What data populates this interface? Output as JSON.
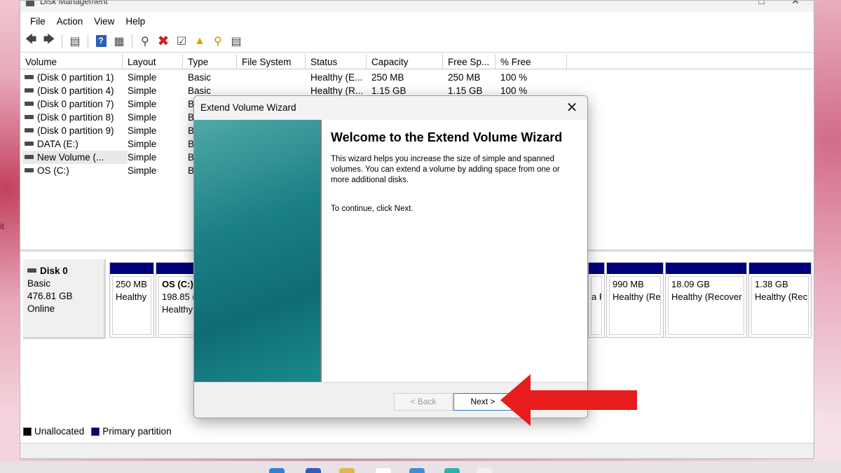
{
  "window": {
    "title": "Disk Management",
    "menu": [
      "File",
      "Action",
      "View",
      "Help"
    ]
  },
  "toolbar_icons": [
    "back-arrow-icon",
    "forward-arrow-icon",
    "console-tree-icon",
    "help-icon",
    "details-pane-icon",
    "connect-icon",
    "delete-icon",
    "properties-icon",
    "rescan-icon",
    "search-icon",
    "wizard-icon"
  ],
  "volume_table": {
    "columns": [
      "Volume",
      "Layout",
      "Type",
      "File System",
      "Status",
      "Capacity",
      "Free Sp...",
      "% Free"
    ],
    "rows": [
      {
        "volume": "(Disk 0 partition 1)",
        "layout": "Simple",
        "type": "Basic",
        "fs": "",
        "status": "Healthy (E...",
        "capacity": "250 MB",
        "free": "250 MB",
        "pct": "100 %"
      },
      {
        "volume": "(Disk 0 partition 4)",
        "layout": "Simple",
        "type": "Basic",
        "fs": "",
        "status": "Healthy (R...",
        "capacity": "1.15 GB",
        "free": "1.15 GB",
        "pct": "100 %"
      },
      {
        "volume": "(Disk 0 partition 7)",
        "layout": "Simple",
        "type": "B",
        "fs": "",
        "status": "",
        "capacity": "",
        "free": "",
        "pct": ""
      },
      {
        "volume": "(Disk 0 partition 8)",
        "layout": "Simple",
        "type": "B",
        "fs": "",
        "status": "",
        "capacity": "",
        "free": "",
        "pct": ""
      },
      {
        "volume": "(Disk 0 partition 9)",
        "layout": "Simple",
        "type": "B",
        "fs": "",
        "status": "",
        "capacity": "",
        "free": "",
        "pct": ""
      },
      {
        "volume": "DATA (E:)",
        "layout": "Simple",
        "type": "B",
        "fs": "",
        "status": "",
        "capacity": "",
        "free": "",
        "pct": ""
      },
      {
        "volume": "New Volume (...",
        "layout": "Simple",
        "type": "B",
        "fs": "",
        "status": "",
        "capacity": "",
        "free": "",
        "pct": ""
      },
      {
        "volume": "OS (C:)",
        "layout": "Simple",
        "type": "B",
        "fs": "",
        "status": "",
        "capacity": "",
        "free": "",
        "pct": ""
      }
    ]
  },
  "disk": {
    "name": "Disk 0",
    "kind": "Basic",
    "size": "476.81 GB",
    "state": "Online",
    "partitions": [
      {
        "name": "",
        "size": "250 MB",
        "status": "Healthy"
      },
      {
        "name": "OS  (C:)",
        "size": "198.85 (",
        "status": "Healthy"
      },
      {
        "name": "",
        "size": "",
        "status": "a P"
      },
      {
        "name": "",
        "size": "990 MB",
        "status": "Healthy (Re"
      },
      {
        "name": "",
        "size": "18.09 GB",
        "status": "Healthy (Recover"
      },
      {
        "name": "",
        "size": "1.38 GB",
        "status": "Healthy (Rec"
      }
    ]
  },
  "legend": [
    {
      "label": "Unallocated",
      "color": "#000000"
    },
    {
      "label": "Primary partition",
      "color": "#00007f"
    }
  ],
  "wizard": {
    "title": "Extend Volume Wizard",
    "heading": "Welcome to the Extend Volume Wizard",
    "body": "This wizard helps you increase the size of simple and spanned volumes. You can extend a volume  by adding space from one or more additional disks.",
    "continue": "To continue, click Next.",
    "back_label": "< Back",
    "next_label": "Next >"
  },
  "left_edge_text": "it",
  "colors": {
    "primary_partition": "#00007f",
    "wizard_sidebar": "#0f6c76",
    "annotation_arrow": "#e81c1c",
    "next_button_border": "#2b74c9"
  }
}
